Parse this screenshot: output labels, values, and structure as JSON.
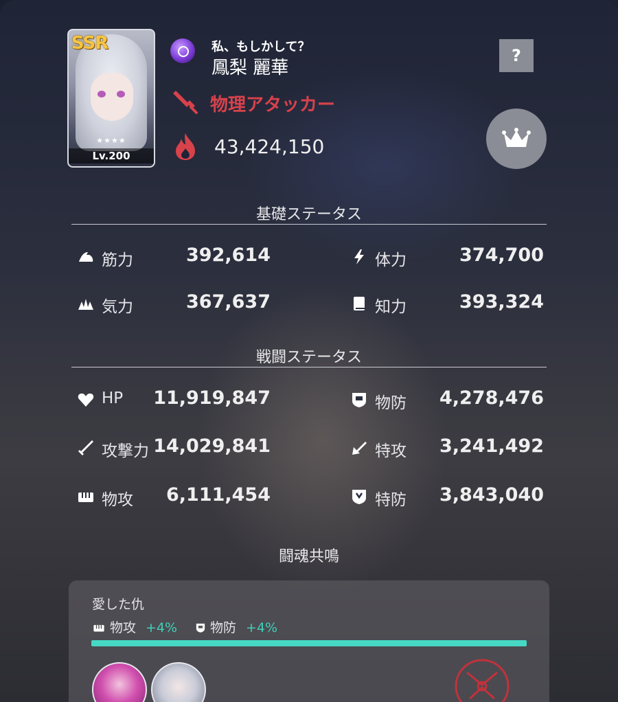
{
  "character": {
    "rarity": "SSR",
    "stars": "★★★★",
    "level": "Lv.200",
    "subtitle": "私、もしかして？",
    "name": "鳳梨 麗華",
    "role": "物理アタッカー",
    "combat_power": "43,424,150",
    "role_color": "#d8424b"
  },
  "buttons": {
    "help": "?",
    "crown_icon": "crown-icon"
  },
  "basic_status": {
    "title": "基礎ステータス",
    "left": [
      {
        "label": "筋力",
        "value": "392,614",
        "icon": "muscle-icon"
      },
      {
        "label": "気力",
        "value": "367,637",
        "icon": "spirit-icon"
      }
    ],
    "right": [
      {
        "label": "体力",
        "value": "374,700",
        "icon": "lightning-icon"
      },
      {
        "label": "知力",
        "value": "393,324",
        "icon": "book-icon"
      }
    ]
  },
  "battle_status": {
    "title": "戦闘ステータス",
    "left": [
      {
        "label": "HP",
        "value": "11,919,847",
        "icon": "heart-icon"
      },
      {
        "label": "攻撃力",
        "value": "14,029,841",
        "icon": "sword-icon"
      },
      {
        "label": "物攻",
        "value": "6,111,454",
        "icon": "fist-icon"
      }
    ],
    "right": [
      {
        "label": "物防",
        "value": "4,278,476",
        "icon": "shield-icon"
      },
      {
        "label": "特攻",
        "value": "3,241,492",
        "icon": "arrow-icon"
      },
      {
        "label": "特防",
        "value": "3,843,040",
        "icon": "magic-shield-icon"
      }
    ]
  },
  "resonance": {
    "title": "闘魂共鳴",
    "bond_name": "愛した仇",
    "buffs": [
      {
        "label": "物攻",
        "value": "+4%"
      },
      {
        "label": "物防",
        "value": "+4%"
      }
    ],
    "progress": 1.0,
    "accent_color": "#46d8c4"
  }
}
